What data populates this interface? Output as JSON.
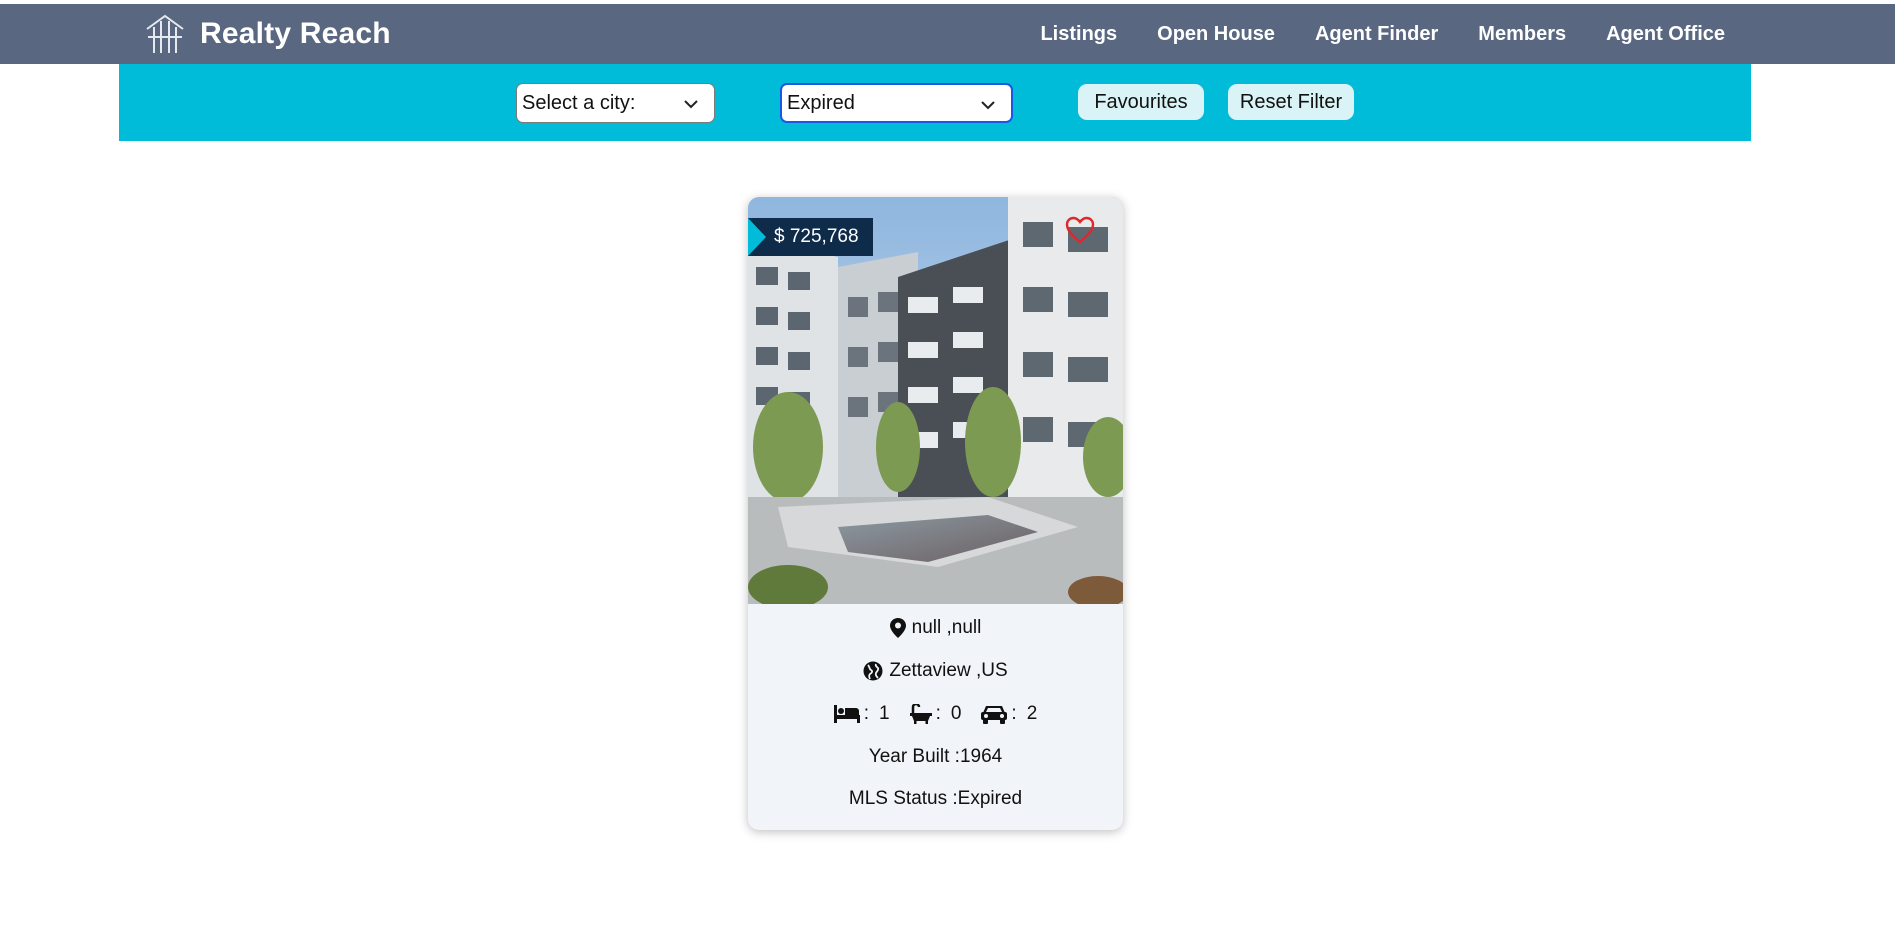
{
  "brand": {
    "name": "Realty Reach",
    "logo_icon": "building-logo-icon"
  },
  "nav": {
    "items": [
      {
        "label": "Listings"
      },
      {
        "label": "Open House"
      },
      {
        "label": "Agent Finder"
      },
      {
        "label": "Members"
      },
      {
        "label": "Agent Office"
      }
    ]
  },
  "filters": {
    "city_select": {
      "value": "Select a city:"
    },
    "status_select": {
      "value": "Expired"
    },
    "favourites_label": "Favourites",
    "reset_label": "Reset Filter"
  },
  "listing": {
    "price": "$ 725,768",
    "address": "null ,null",
    "location": "Zettaview ,US",
    "beds": "1",
    "baths": "0",
    "parking": "2",
    "year_built": "Year Built :1964",
    "mls_status": "MLS Status :Expired",
    "favorited": false
  },
  "colors": {
    "navbar": "#5a6781",
    "filterbar": "#00bcd9",
    "price_tag": "#0f2b4a",
    "heart": "#e0282c",
    "card": "#f1f4f9"
  }
}
